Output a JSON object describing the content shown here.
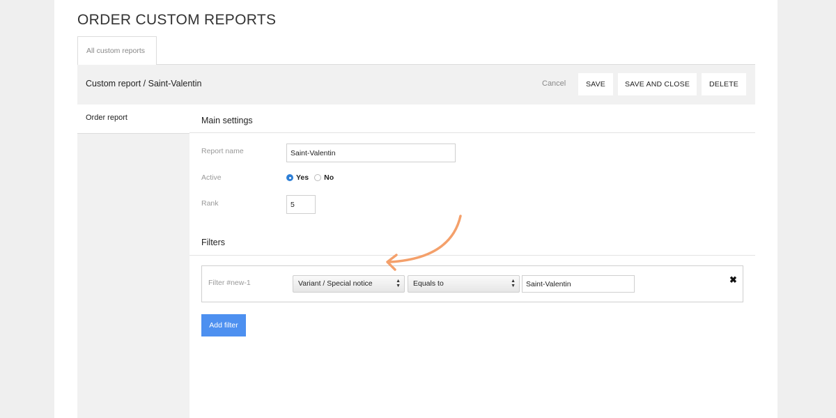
{
  "page": {
    "title": "ORDER CUSTOM REPORTS"
  },
  "tabs": [
    {
      "label": "All custom reports"
    }
  ],
  "header": {
    "title": "Custom report / Saint-Valentin",
    "cancel_label": "Cancel",
    "save_label": "SAVE",
    "save_close_label": "SAVE AND CLOSE",
    "delete_label": "DELETE"
  },
  "sidebar": {
    "items": [
      {
        "label": "Order report"
      }
    ]
  },
  "main_settings": {
    "title": "Main settings",
    "report_name": {
      "label": "Report name",
      "value": "Saint-Valentin"
    },
    "active": {
      "label": "Active",
      "options": [
        {
          "label": "Yes",
          "checked": true
        },
        {
          "label": "No",
          "checked": false
        }
      ]
    },
    "rank": {
      "label": "Rank",
      "value": "5"
    }
  },
  "filters": {
    "title": "Filters",
    "items": [
      {
        "label": "Filter #new-1",
        "field": "Variant / Special notice",
        "operator": "Equals to",
        "value": "Saint-Valentin"
      }
    ],
    "add_label": "Add filter"
  },
  "colors": {
    "accent": "#4d90f0",
    "annotation_arrow": "#f4a06b",
    "radio_checked": "#2e7fd6"
  },
  "icons": {
    "remove": "close-x-icon",
    "select_arrows": "up-down-arrows-icon",
    "annotation": "curved-arrow-icon"
  }
}
